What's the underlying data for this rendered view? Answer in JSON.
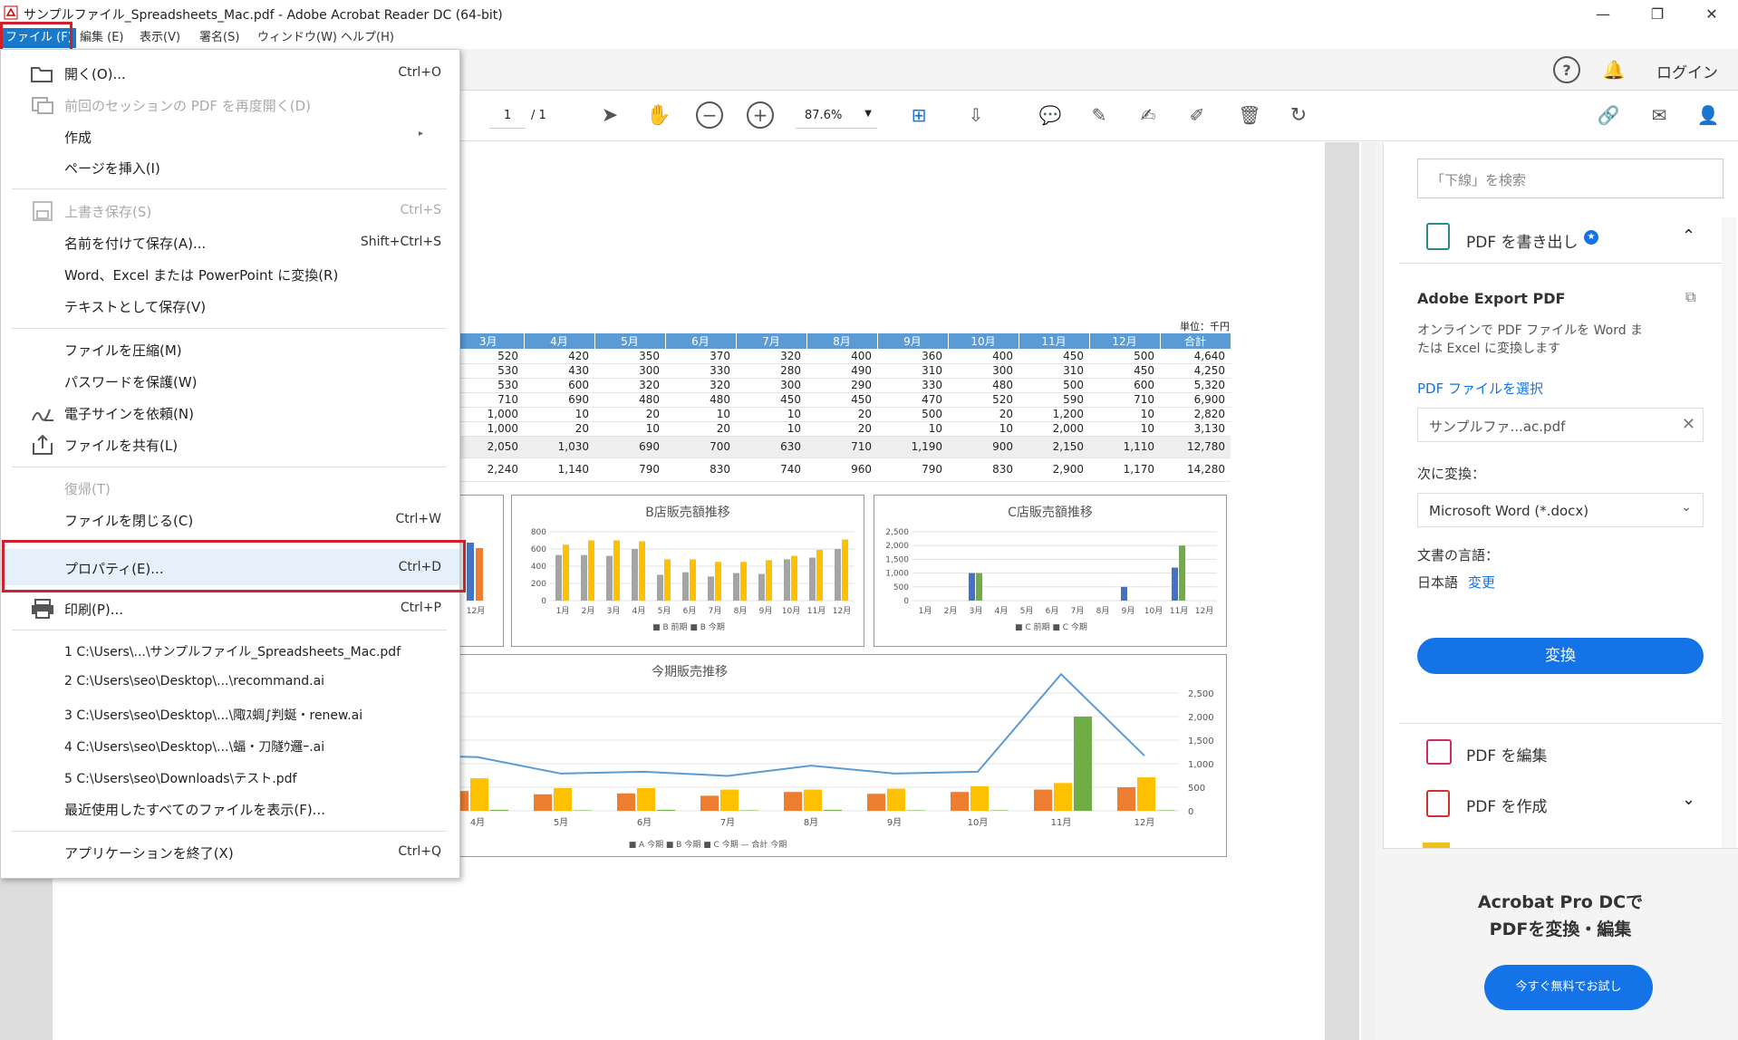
{
  "window": {
    "title": "サンプルファイル_Spreadsheets_Mac.pdf - Adobe Acrobat Reader DC (64-bit)",
    "minimize": "—",
    "restore": "❐",
    "close": "✕"
  },
  "menubar": {
    "items": [
      "ファイル (F)",
      "編集 (E)",
      "表示(V)",
      "署名(S)",
      "ウィンドウ(W)",
      "ヘルプ(H)"
    ]
  },
  "toolbar_top": {
    "login": "ログイン"
  },
  "toolbar": {
    "page_current": "1",
    "page_total": "/ 1",
    "zoom": "87.6%"
  },
  "file_menu": {
    "items": [
      {
        "label": "開く(O)...",
        "shortcut": "Ctrl+O",
        "icon": "folder-open-icon"
      },
      {
        "label": "前回のセッションの PDF を再度開く(D)",
        "shortcut": "",
        "icon": "reopen-icon",
        "disabled": true
      },
      {
        "label": "作成",
        "shortcut": "▸"
      },
      {
        "label": "ページを挿入(I)",
        "shortcut": ""
      },
      {
        "label": "上書き保存(S)",
        "shortcut": "Ctrl+S",
        "icon": "save-icon",
        "disabled": true
      },
      {
        "label": "名前を付けて保存(A)...",
        "shortcut": "Shift+Ctrl+S"
      },
      {
        "label": "Word、Excel または PowerPoint に変換(R)",
        "shortcut": ""
      },
      {
        "label": "テキストとして保存(V)",
        "shortcut": ""
      },
      {
        "label": "ファイルを圧縮(M)",
        "shortcut": ""
      },
      {
        "label": "パスワードを保護(W)",
        "shortcut": ""
      },
      {
        "label": "電子サインを依頼(N)",
        "shortcut": "",
        "icon": "sign-icon"
      },
      {
        "label": "ファイルを共有(L)",
        "shortcut": "",
        "icon": "share-icon"
      },
      {
        "label": "復帰(T)",
        "shortcut": "",
        "disabled": true
      },
      {
        "label": "ファイルを閉じる(C)",
        "shortcut": "Ctrl+W"
      },
      {
        "label": "プロパティ(E)...",
        "shortcut": "Ctrl+D"
      },
      {
        "label": "印刷(P)...",
        "shortcut": "Ctrl+P",
        "icon": "print-icon"
      },
      {
        "label": "1 C:\\Users\\...\\サンプルファイル_Spreadsheets_Mac.pdf",
        "shortcut": ""
      },
      {
        "label": "2 C:\\Users\\seo\\Desktop\\...\\recommand.ai",
        "shortcut": ""
      },
      {
        "label": "3 C:\\Users\\seo\\Desktop\\...\\陬ｽ蜩∫判蜒・renew.ai",
        "shortcut": ""
      },
      {
        "label": "4 C:\\Users\\seo\\Desktop\\...\\蝠・刀隧ｳ邏ｰ.ai",
        "shortcut": ""
      },
      {
        "label": "5 C:\\Users\\seo\\Downloads\\テスト.pdf",
        "shortcut": ""
      },
      {
        "label": "最近使用したすべてのファイルを表示(F)...",
        "shortcut": ""
      },
      {
        "label": "アプリケーションを終了(X)",
        "shortcut": "Ctrl+Q"
      }
    ]
  },
  "document": {
    "unit": "単位：千円",
    "headers": [
      "3月",
      "4月",
      "5月",
      "6月",
      "7月",
      "8月",
      "9月",
      "10月",
      "11月",
      "12月",
      "合計"
    ],
    "rows": [
      [
        "520",
        "420",
        "350",
        "370",
        "320",
        "400",
        "360",
        "400",
        "450",
        "500",
        "4,640"
      ],
      [
        "530",
        "430",
        "300",
        "330",
        "280",
        "490",
        "310",
        "300",
        "310",
        "450",
        "4,250"
      ],
      [
        "530",
        "600",
        "320",
        "320",
        "300",
        "290",
        "330",
        "480",
        "500",
        "600",
        "5,320"
      ],
      [
        "710",
        "690",
        "480",
        "480",
        "450",
        "450",
        "470",
        "520",
        "590",
        "710",
        "6,900"
      ],
      [
        "1,000",
        "10",
        "20",
        "10",
        "10",
        "20",
        "500",
        "20",
        "1,200",
        "10",
        "2,820"
      ],
      [
        "1,000",
        "20",
        "10",
        "20",
        "10",
        "20",
        "10",
        "10",
        "2,000",
        "10",
        "3,130"
      ],
      [
        "2,050",
        "1,030",
        "690",
        "700",
        "630",
        "710",
        "1,190",
        "900",
        "2,150",
        "1,110",
        "12,780"
      ],
      [
        "2,240",
        "1,140",
        "790",
        "830",
        "740",
        "960",
        "790",
        "830",
        "2,900",
        "1,170",
        "14,280"
      ]
    ]
  },
  "charts": {
    "b_title": "B店販売額推移",
    "c_title": "C店販売額推移",
    "main_title": "今期販売推移",
    "b_legend": "■ B 前期 ■ B 今期",
    "c_legend": "■ C 前期 ■ C 今期",
    "main_legend": "■ A 今期  ■ B 今期  ■ C 今期  — 合計 今期",
    "small_x": [
      "1月",
      "2月",
      "3月",
      "4月",
      "5月",
      "6月",
      "7月",
      "8月",
      "9月",
      "10月",
      "11月",
      "12月"
    ],
    "main_x": [
      "4月",
      "5月",
      "6月",
      "7月",
      "8月",
      "9月",
      "10月",
      "11月",
      "12月"
    ],
    "b_y": [
      "800",
      "600",
      "400",
      "200",
      "0"
    ],
    "c_y": [
      "2,500",
      "2,000",
      "1,500",
      "1,000",
      "500",
      "0"
    ],
    "main_y": [
      "2,500",
      "2,000",
      "1,500",
      "1,000",
      "500",
      "0"
    ],
    "a_prev_tick": "12月"
  },
  "chart_data": [
    {
      "type": "bar",
      "title": "B店販売額推移",
      "categories": [
        "1月",
        "2月",
        "3月",
        "4月",
        "5月",
        "6月",
        "7月",
        "8月",
        "9月",
        "10月",
        "11月",
        "12月"
      ],
      "series": [
        {
          "name": "B 前期",
          "values": [
            530,
            530,
            520,
            600,
            300,
            330,
            280,
            320,
            310,
            480,
            500,
            600
          ]
        },
        {
          "name": "B 今期",
          "values": [
            650,
            700,
            700,
            690,
            480,
            480,
            450,
            450,
            470,
            520,
            590,
            710
          ]
        }
      ],
      "ylim": [
        0,
        800
      ]
    },
    {
      "type": "bar",
      "title": "C店販売額推移",
      "categories": [
        "1月",
        "2月",
        "3月",
        "4月",
        "5月",
        "6月",
        "7月",
        "8月",
        "9月",
        "10月",
        "11月",
        "12月"
      ],
      "series": [
        {
          "name": "C 前期",
          "values": [
            0,
            0,
            1000,
            0,
            0,
            0,
            0,
            0,
            500,
            0,
            1200,
            0
          ]
        },
        {
          "name": "C 今期",
          "values": [
            0,
            0,
            1000,
            0,
            0,
            0,
            0,
            0,
            0,
            0,
            2000,
            0
          ]
        }
      ],
      "ylim": [
        0,
        2500
      ]
    },
    {
      "type": "bar",
      "title": "今期販売推移",
      "categories": [
        "4月",
        "5月",
        "6月",
        "7月",
        "8月",
        "9月",
        "10月",
        "11月",
        "12月"
      ],
      "series": [
        {
          "name": "A 今期",
          "values": [
            420,
            350,
            370,
            320,
            400,
            360,
            400,
            450,
            500
          ]
        },
        {
          "name": "B 今期",
          "values": [
            690,
            480,
            480,
            450,
            450,
            470,
            520,
            590,
            710
          ]
        },
        {
          "name": "C 今期",
          "values": [
            20,
            10,
            20,
            10,
            20,
            10,
            10,
            2000,
            10
          ]
        },
        {
          "name": "合計 今期",
          "values": [
            1140,
            790,
            830,
            740,
            960,
            790,
            830,
            2900,
            1170
          ]
        }
      ],
      "ylim": [
        0,
        2500
      ]
    }
  ],
  "right_panel": {
    "search_placeholder": "「下線」を検索",
    "export_title": "PDF を書き出し",
    "adobe_export": "Adobe Export PDF",
    "export_desc1": "オンラインで PDF ファイルを Word ま",
    "export_desc2": "たは Excel に変換します",
    "select_file": "PDF ファイルを選択",
    "file_name": "サンプルファ...ac.pdf",
    "convert_to": "次に変換：",
    "format": "Microsoft Word (*.docx)",
    "language_label": "文書の言語：",
    "language": "日本語",
    "change": "変更",
    "convert_btn": "変換",
    "edit_pdf": "PDF を編集",
    "create_pdf": "PDF を作成",
    "promo1": "Acrobat Pro DCで",
    "promo2": "PDFを変換・編集",
    "trial_btn": "今すぐ無料でお試し"
  },
  "colors": {
    "accent": "#1473e6",
    "menu_active": "#1979ca",
    "red_highlight": "#d0202b",
    "bar_blue": "#4472c4",
    "bar_orange": "#ed7d31",
    "bar_gray": "#a5a5a5",
    "bar_yellow": "#ffc000",
    "bar_green": "#70ad47",
    "line_blue": "#5b9bd5"
  }
}
